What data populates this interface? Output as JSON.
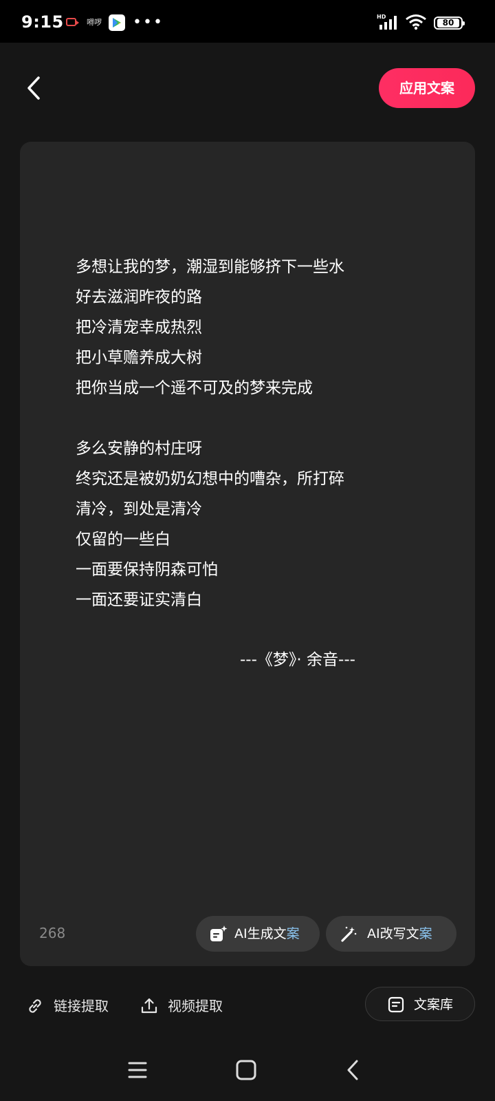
{
  "status_bar": {
    "time": "9:15",
    "app_label": "嘚啰",
    "dots": "•••",
    "network": "HD",
    "battery": "80"
  },
  "header": {
    "apply_button": "应用文案"
  },
  "poem": {
    "lines": [
      "多想让我的梦，潮湿到能够挤下一些水",
      "好去滋润昨夜的路",
      "把冷清宠幸成热烈",
      "把小草赡养成大树",
      "把你当成一个遥不可及的梦来完成",
      "",
      "多么安静的村庄呀",
      "终究还是被奶奶幻想中的嘈杂，所打碎",
      "清冷，到处是清冷",
      "仅留的一些白",
      "一面要保持阴森可怕",
      "一面还要证实清白"
    ],
    "signature": "---《梦》· 余音---"
  },
  "editor": {
    "char_count": "268",
    "ai_generate_main": "AI生成文",
    "ai_generate_accent": "案",
    "ai_rewrite_main": "AI改写文",
    "ai_rewrite_accent": "案"
  },
  "bottom_tools": {
    "link_extract": "链接提取",
    "video_extract": "视频提取",
    "library": "文案库"
  },
  "colors": {
    "accent": "#fe2e63",
    "background": "#161616",
    "card": "#262626"
  },
  "icons": [
    "back-icon",
    "ai-generate-icon",
    "magic-wand-icon",
    "link-icon",
    "upload-icon",
    "document-icon",
    "menu-icon",
    "home-icon",
    "nav-back-icon"
  ]
}
